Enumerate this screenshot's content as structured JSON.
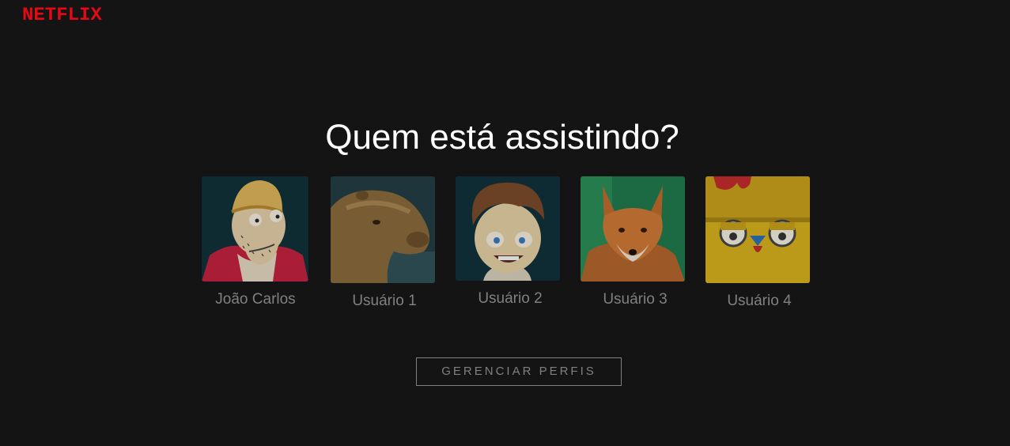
{
  "brand": {
    "logo_text": "NETFLIX",
    "color": "#e50914"
  },
  "title": "Quem está assistindo?",
  "profiles": [
    {
      "name": "João Carlos",
      "avatar_icon": "bearded-man-beanie-avatar"
    },
    {
      "name": "Usuário 1",
      "avatar_icon": "capybara-avatar"
    },
    {
      "name": "Usuário 2",
      "avatar_icon": "cartoon-boy-avatar"
    },
    {
      "name": "Usuário 3",
      "avatar_icon": "fox-avatar"
    },
    {
      "name": "Usuário 4",
      "avatar_icon": "yellow-chicken-avatar"
    }
  ],
  "manage_button": "GERENCIAR PERFIS",
  "colors": {
    "background": "#141414",
    "text_muted": "#808080",
    "title": "#ffffff"
  }
}
